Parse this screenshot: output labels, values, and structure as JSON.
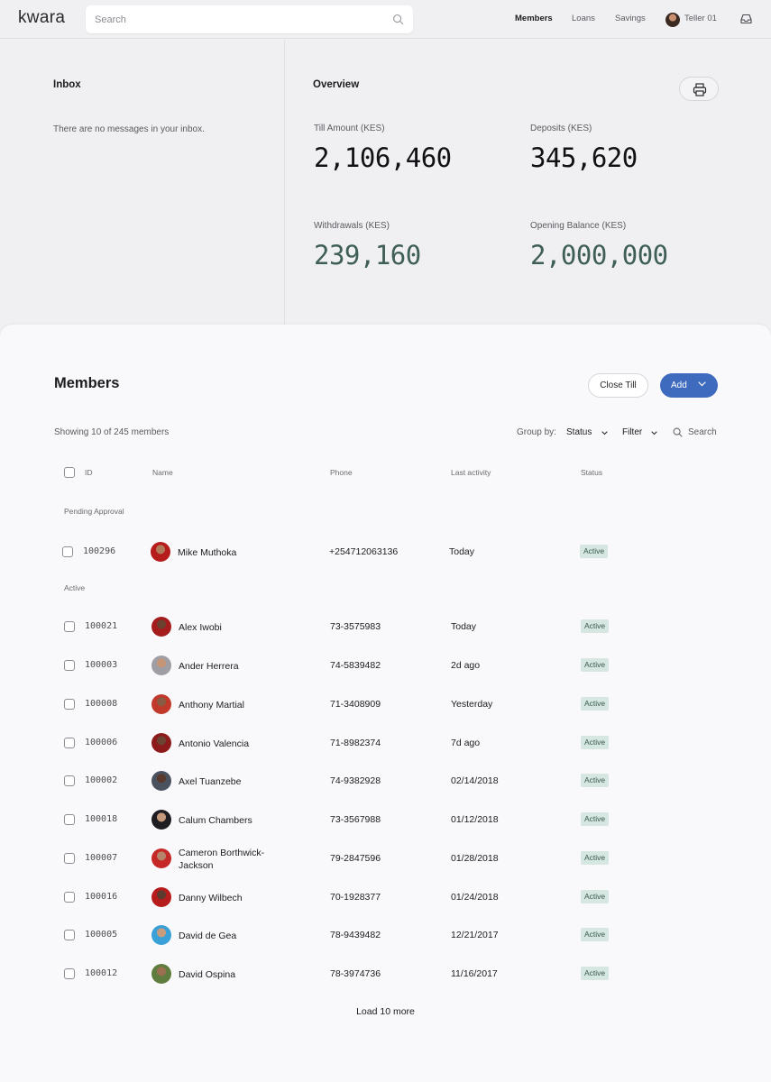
{
  "app": {
    "logo": "kwara"
  },
  "search": {
    "placeholder": "Search"
  },
  "nav": {
    "members": "Members",
    "loans": "Loans",
    "savings": "Savings",
    "user": "Teller 01"
  },
  "inbox": {
    "title": "Inbox",
    "empty_text": "There are no messages in your inbox."
  },
  "overview": {
    "title": "Overview",
    "stats": [
      {
        "label": "Till Amount (KES)",
        "value": "2,106,460"
      },
      {
        "label": "Deposits (KES)",
        "value": "345,620"
      },
      {
        "label": "Withdrawals (KES)",
        "value": "239,160"
      },
      {
        "label": "Opening Balance (KES)",
        "value": "2,000,000"
      }
    ]
  },
  "members": {
    "title": "Members",
    "close_till": "Close Till",
    "add": "Add",
    "showing": "Showing 10 of 245 members",
    "group_by_label": "Group by:",
    "group_by_value": "Status",
    "filter": "Filter",
    "search": "Search",
    "columns": {
      "id": "ID",
      "name": "Name",
      "phone": "Phone",
      "last_activity": "Last activity",
      "status": "Status"
    },
    "groups": {
      "pending": "Pending Approval",
      "active": "Active"
    },
    "pending_rows": [
      {
        "id": "100296",
        "name": "Mike Muthoka",
        "phone": "+254712063136",
        "activity": "Today",
        "status": "Active"
      }
    ],
    "active_rows": [
      {
        "id": "100021",
        "name": "Alex Iwobi",
        "phone": "73-3575983",
        "activity": "Today",
        "status": "Active"
      },
      {
        "id": "100003",
        "name": "Ander Herrera",
        "phone": "74-5839482",
        "activity": "2d ago",
        "status": "Active"
      },
      {
        "id": "100008",
        "name": "Anthony Martial",
        "phone": "71-3408909",
        "activity": "Yesterday",
        "status": "Active"
      },
      {
        "id": "100006",
        "name": "Antonio Valencia",
        "phone": "71-8982374",
        "activity": "7d ago",
        "status": "Active"
      },
      {
        "id": "100002",
        "name": "Axel Tuanzebe",
        "phone": "74-9382928",
        "activity": "02/14/2018",
        "status": "Active"
      },
      {
        "id": "100018",
        "name": "Calum Chambers",
        "phone": "73-3567988",
        "activity": "01/12/2018",
        "status": "Active"
      },
      {
        "id": "100007",
        "name": "Cameron Borthwick-Jackson",
        "phone": "79-2847596",
        "activity": "01/28/2018",
        "status": "Active"
      },
      {
        "id": "100016",
        "name": "Danny Wilbech",
        "phone": "70-1928377",
        "activity": "01/24/2018",
        "status": "Active"
      },
      {
        "id": "100005",
        "name": "David de Gea",
        "phone": "78-9439482",
        "activity": "12/21/2017",
        "status": "Active"
      },
      {
        "id": "100012",
        "name": "David Ospina",
        "phone": "78-3974736",
        "activity": "11/16/2017",
        "status": "Active"
      }
    ],
    "load_more": "Load 10 more"
  },
  "colors": {
    "accent": "#3f6bbf",
    "badge_bg": "#d6e6e1",
    "badge_text": "#3a5a52",
    "stat_green": "#3e5e56"
  }
}
